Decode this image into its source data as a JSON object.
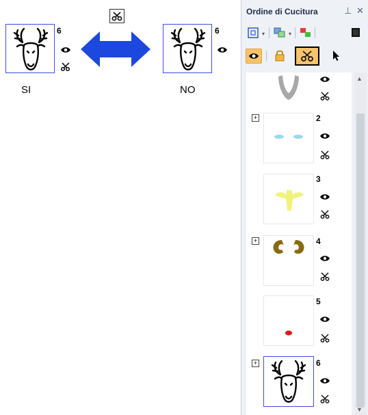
{
  "illustration": {
    "toolbar_icon": "scissors-icon",
    "left_example": {
      "number": "6",
      "caption": "SI",
      "eye_icon": "eye-icon",
      "cut_icon": "scissors-icon"
    },
    "right_example": {
      "number": "6",
      "caption": "NO",
      "eye_icon": "eye-icon",
      "cut_icon": "scissors-icon"
    },
    "arrow_color": "#1c48e0",
    "frame_color": "#3a4fd8"
  },
  "panel": {
    "title": "Ordine di Cucitura",
    "pin_icon": "pin-icon",
    "close_icon": "close-icon",
    "toolbar": [
      {
        "icon": "fit-to-window-icon",
        "has_dropdown": true
      },
      {
        "icon": "object-order-icon",
        "has_dropdown": true
      },
      {
        "icon": "color-blocks-icon",
        "has_dropdown": false
      },
      {
        "icon": "color-stop-icon",
        "has_dropdown": false
      }
    ],
    "toolbar2": [
      {
        "icon": "eye-icon",
        "state": "active"
      },
      {
        "icon": "lock-icon",
        "state": "normal"
      },
      {
        "icon": "scissors-icon",
        "state": "selected"
      },
      {
        "icon": "cursor-icon",
        "state": "normal"
      }
    ],
    "items": [
      {
        "number": "",
        "has_expand": false,
        "shape": "v-shape",
        "color": "#a8a8a8"
      },
      {
        "number": "2",
        "has_expand": true,
        "shape": "eyes",
        "color": "#9dd8ea"
      },
      {
        "number": "3",
        "has_expand": false,
        "shape": "antlers",
        "color": "#f2f27a"
      },
      {
        "number": "4",
        "has_expand": true,
        "shape": "ears",
        "color": "#8a6a10"
      },
      {
        "number": "5",
        "has_expand": false,
        "shape": "dot",
        "color": "#e01818"
      },
      {
        "number": "6",
        "has_expand": true,
        "shape": "moose-head",
        "color": "#000000",
        "selected": true
      }
    ]
  }
}
